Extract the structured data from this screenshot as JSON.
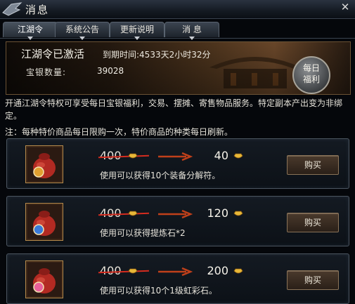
{
  "window": {
    "title": "消息",
    "close_glyph": "✕"
  },
  "tabs": [
    {
      "label": "江湖令",
      "active": true
    },
    {
      "label": "系统公告",
      "active": false
    },
    {
      "label": "更新说明",
      "active": false
    },
    {
      "label": "消 息",
      "active": false
    }
  ],
  "banner": {
    "status": "江湖令已激活",
    "expire_text": "到期时间:4533天2小时32分",
    "silver_label": "宝银数量:",
    "silver_value": "39028",
    "seal_line1": "每日",
    "seal_line2": "福利"
  },
  "description": "开通江湖令特权可享受每日宝银福利，交易、摆摊、寄售物品服务。特定副本产出变为非绑定。",
  "note": "注：每种特价商品每日限购一次，特价商品的种类每日刷新。",
  "items": [
    {
      "old_price": "400",
      "new_price": "40",
      "desc": "使用可以获得10个装备分解符。",
      "buy_label": "购买",
      "icon": "red-bag-icon",
      "badge_color": "#e0a030"
    },
    {
      "old_price": "400",
      "new_price": "120",
      "desc": "使用可以获得提炼石*2",
      "buy_label": "购买",
      "icon": "red-bag-icon",
      "badge_color": "#3a7ad8"
    },
    {
      "old_price": "400",
      "new_price": "200",
      "desc": "使用可以获得10个1级虹彩石。",
      "buy_label": "购买",
      "icon": "red-bag-icon",
      "badge_color": "#e8609a"
    }
  ],
  "colors": {
    "strike": "#d52c1f",
    "ingot": "#e8b838",
    "frame": "#b58a4c"
  }
}
